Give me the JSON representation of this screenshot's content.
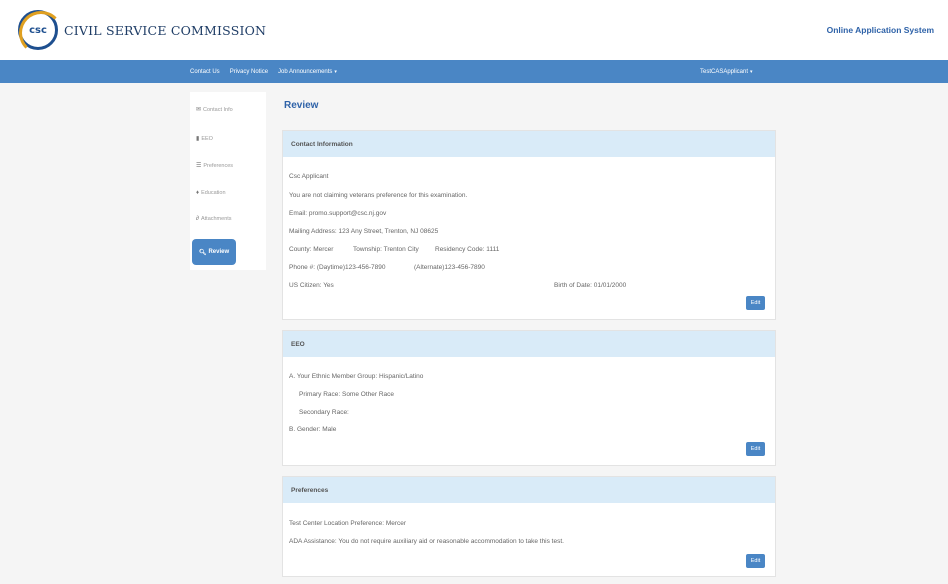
{
  "header": {
    "logo_abbr": "csc",
    "org_name": "CIVIL SERVICE COMMISSION",
    "system_name": "Online Application System"
  },
  "nav": {
    "links": [
      "Contact Us",
      "Privacy Notice",
      "Job Announcements"
    ],
    "user": "TestCASApplicant"
  },
  "sidebar": {
    "items": [
      {
        "label": "Contact Info",
        "icon": "envelope-icon"
      },
      {
        "label": "EEO",
        "icon": "bookmark-icon"
      },
      {
        "label": "Preferences",
        "icon": "list-icon"
      },
      {
        "label": "Education",
        "icon": "graduation-cap-icon"
      },
      {
        "label": "Attachments",
        "icon": "paperclip-icon"
      }
    ],
    "active": {
      "label": "Review",
      "icon": "search-icon"
    }
  },
  "main": {
    "title": "Review",
    "contact": {
      "heading": "Contact Information",
      "name": "Csc Applicant",
      "veteran": "You are not claiming veterans preference for this examination.",
      "email": "Email: promo.support@csc.nj.gov",
      "address": "Mailing Address: 123 Any Street, Trenton, NJ 08625",
      "county": "County: Mercer",
      "township": "Township: Trenton City",
      "residency": "Residency Code: 1111",
      "phone": "Phone #: (Daytime)123-456-7890",
      "phone_alt": "(Alternate)123-456-7890",
      "citizen": "US Citizen: Yes",
      "birth": "Birth of Date: 01/01/2000",
      "edit": "Edit"
    },
    "eeo": {
      "heading": "EEO",
      "ethnic": "A. Your Ethnic Member Group: Hispanic/Latino",
      "primary_race": "Primary Race: Some Other Race",
      "secondary_race": "Secondary Race:",
      "gender": "B. Gender: Male",
      "edit": "Edit"
    },
    "preferences": {
      "heading": "Preferences",
      "location": "Test Center Location Preference: Mercer",
      "ada": "ADA Assistance: You do not require auxiliary aid or reasonable accommodation to take this test.",
      "edit": "Edit"
    }
  }
}
